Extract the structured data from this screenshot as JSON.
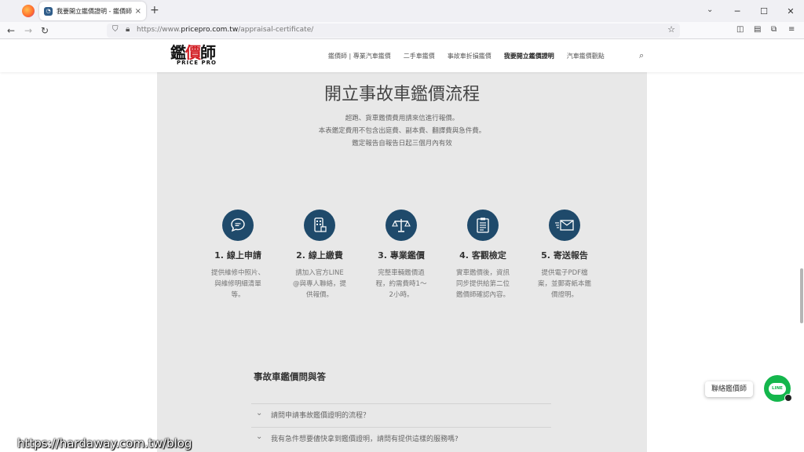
{
  "browser": {
    "tab_title": "我要開立鑑價證明 - 鑑價師 | 專",
    "tab_close": "×",
    "new_tab": "+",
    "url_base": "https://www.",
    "url_domain": "pricepro.com.tw",
    "url_path": "/appraisal-certificate/"
  },
  "site": {
    "logo_text_1": "鑑",
    "logo_text_2": "價",
    "logo_text_3": "師",
    "logo_sub": "PRICE PRO",
    "menu": [
      {
        "label": "鑑價師 | 專業汽車鑑價"
      },
      {
        "label": "二手車鑑價"
      },
      {
        "label": "事故車折損鑑價"
      },
      {
        "label": "我要開立鑑價證明"
      },
      {
        "label": "汽車鑑價觀點"
      }
    ]
  },
  "main": {
    "title": "開立事故車鑑價流程",
    "notes": [
      "超跑、貨車鑑價費用請來信進行報價。",
      "本表鑑定費用不包含出庭費、副本費、翻譯費與急件費。",
      "鑑定報告自報告日起三個月內有效"
    ],
    "steps": [
      {
        "icon": "chat-bubble-icon",
        "title": "1. 線上申請",
        "desc": "提供維修中照片、與維修明細清單等。"
      },
      {
        "icon": "mobile-payment-icon",
        "title": "2. 線上繳費",
        "desc": "請加入官方LINE@與專人聯絡，提供報價。"
      },
      {
        "icon": "scale-icon",
        "title": "3. 專業鑑價",
        "desc": "完整車輛鑑價過程，約需費時1～2小時。"
      },
      {
        "icon": "clipboard-icon",
        "title": "4. 客觀檢定",
        "desc": "實車鑑價後，資訊同步提供給第二位鑑價師確認內容。"
      },
      {
        "icon": "mail-icon",
        "title": "5. 寄送報告",
        "desc": "提供電子PDF檔案，並郵寄紙本鑑價證明。"
      }
    ],
    "faq_heading": "事故車鑑價問與答",
    "faq": [
      {
        "q": "請問申請事故鑑價證明的流程？"
      },
      {
        "q": "我有急件想要儘快拿到鑑價證明，請問有提供這樣的服務嗎?"
      }
    ]
  },
  "floating": {
    "contact_label": "聯絡鑑價師",
    "line_label": "LINE"
  },
  "watermark": "https://hardaway.com.tw/blog",
  "colors": {
    "step_circle": "#1f4a6b",
    "content_bg": "#e8e8e8",
    "line_green": "#14b64c",
    "logo_red": "#d21f25"
  }
}
